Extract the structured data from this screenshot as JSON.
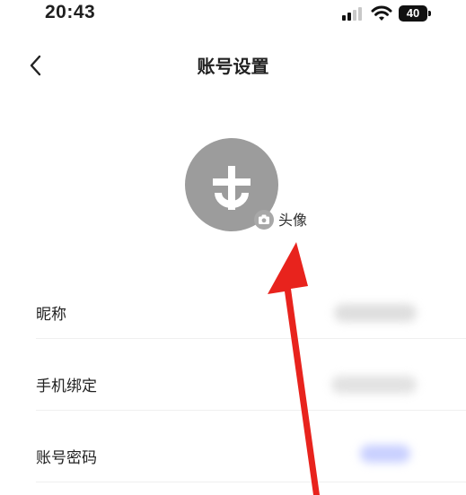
{
  "status_bar": {
    "time": "20:43",
    "battery": "40",
    "icons": [
      "signal-icon",
      "wifi-icon",
      "battery-icon"
    ]
  },
  "nav": {
    "back_icon": "chevron-left-icon",
    "title": "账号设置"
  },
  "avatar": {
    "edit_icon": "camera-icon",
    "label": "头像"
  },
  "settings": [
    {
      "label": "昵称"
    },
    {
      "label": "手机绑定"
    },
    {
      "label": "账号密码"
    }
  ],
  "colors": {
    "avatar_bg": "#9c9c9c",
    "arrow": "#e8231d",
    "link_blue": "#4f6bff"
  }
}
